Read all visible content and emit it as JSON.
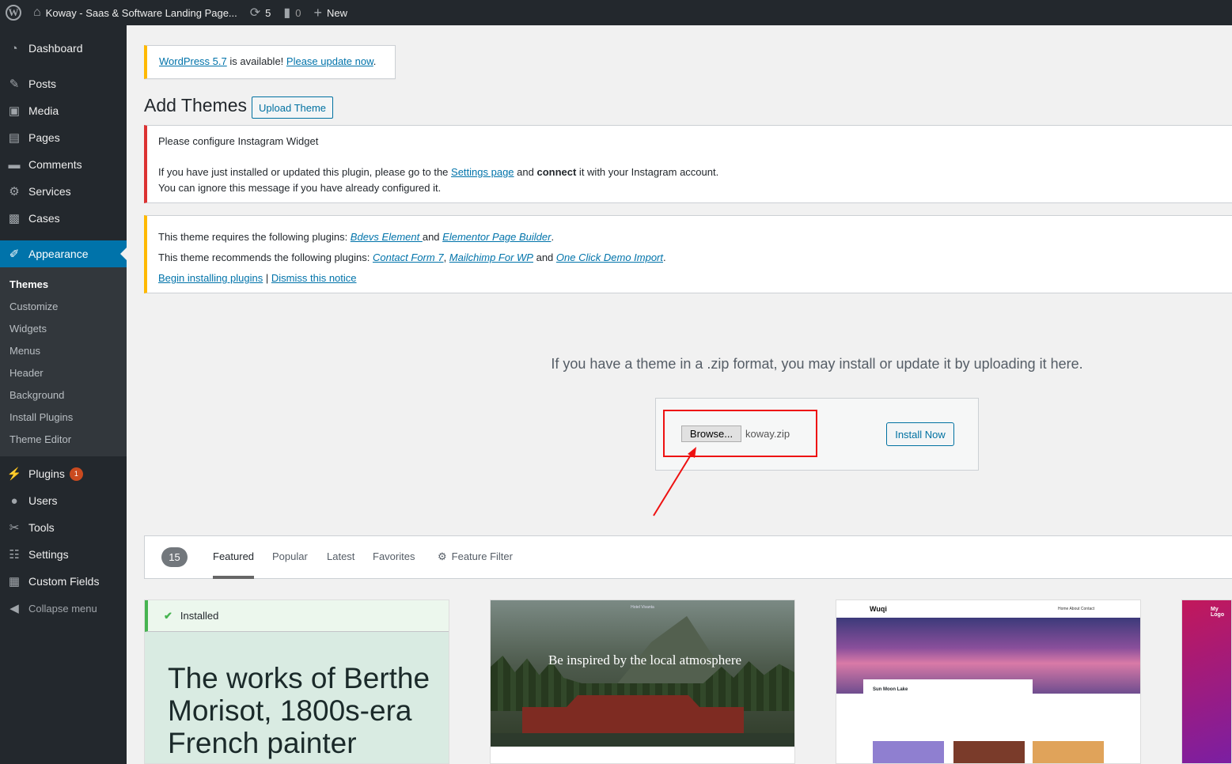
{
  "adminbar": {
    "site_title": "Koway - Saas & Software Landing Page...",
    "updates_count": "5",
    "comments_count": "0",
    "new_label": "New"
  },
  "sidebar": {
    "items": [
      {
        "label": "Dashboard",
        "icon": "dashboard-icon"
      },
      {
        "label": "Posts",
        "icon": "pin-icon"
      },
      {
        "label": "Media",
        "icon": "media-icon"
      },
      {
        "label": "Pages",
        "icon": "pages-icon"
      },
      {
        "label": "Comments",
        "icon": "comment-icon"
      },
      {
        "label": "Services",
        "icon": "gear-icon"
      },
      {
        "label": "Cases",
        "icon": "portfolio-icon"
      },
      {
        "label": "Appearance",
        "icon": "brush-icon"
      }
    ],
    "submenu": [
      "Themes",
      "Customize",
      "Widgets",
      "Menus",
      "Header",
      "Background",
      "Install Plugins",
      "Theme Editor"
    ],
    "items_after": [
      {
        "label": "Plugins",
        "icon": "plug-icon",
        "badge": "1"
      },
      {
        "label": "Users",
        "icon": "user-icon"
      },
      {
        "label": "Tools",
        "icon": "wrench-icon"
      },
      {
        "label": "Settings",
        "icon": "settings-icon"
      },
      {
        "label": "Custom Fields",
        "icon": "table-icon"
      }
    ],
    "collapse_label": "Collapse menu"
  },
  "update_nag": {
    "link1": "WordPress 5.7",
    "text": " is available! ",
    "link2": "Please update now",
    "end": "."
  },
  "page": {
    "title": "Add Themes",
    "upload_button": "Upload Theme"
  },
  "instagram_notice": {
    "heading": "Please configure Instagram Widget",
    "line1_a": "If you have just installed or updated this plugin, please go to the ",
    "line1_link": "Settings page",
    "line1_b": " and ",
    "line1_strong": "connect",
    "line1_c": " it with your Instagram account.",
    "line2": "You can ignore this message if you have already configured it."
  },
  "plugins_notice": {
    "req_text": "This theme requires the following plugins: ",
    "req_1": "Bdevs Element ",
    "req_and": "and ",
    "req_2": "Elementor Page Builder",
    "req_end": ".",
    "rec_text": "This theme recommends the following plugins: ",
    "rec_1": "Contact Form 7",
    "rec_sep": ", ",
    "rec_2": "Mailchimp For WP",
    "rec_and": " and ",
    "rec_3": "One Click Demo Import",
    "rec_end": ".",
    "begin_link": "Begin installing plugins",
    "sep": " | ",
    "dismiss_link": "Dismiss this notice"
  },
  "upload": {
    "instructions": "If you have a theme in a .zip format, you may install or update it by uploading it here.",
    "browse_label": "Browse...",
    "file_name": "koway.zip",
    "install_label": "Install Now"
  },
  "filter": {
    "count": "15",
    "tabs": [
      "Featured",
      "Popular",
      "Latest",
      "Favorites"
    ],
    "feature_filter": "Feature Filter"
  },
  "themes": {
    "installed_label": "Installed",
    "card1_text": "The works of Berthe Morisot, 1800s-era French painter",
    "card2_caption": "Be inspired by the local atmosphere",
    "card2_nav": "Hotel Vivanta",
    "card3_logo": "Wuqi",
    "card3_links": "Home   About   Contact",
    "card3_post_title": "Sun Moon Lake",
    "card4_logo": "My Logo"
  },
  "colors": {
    "accent": "#0073aa",
    "error": "#dc3232",
    "warning": "#ffb900",
    "annotation": "#ee1111"
  }
}
